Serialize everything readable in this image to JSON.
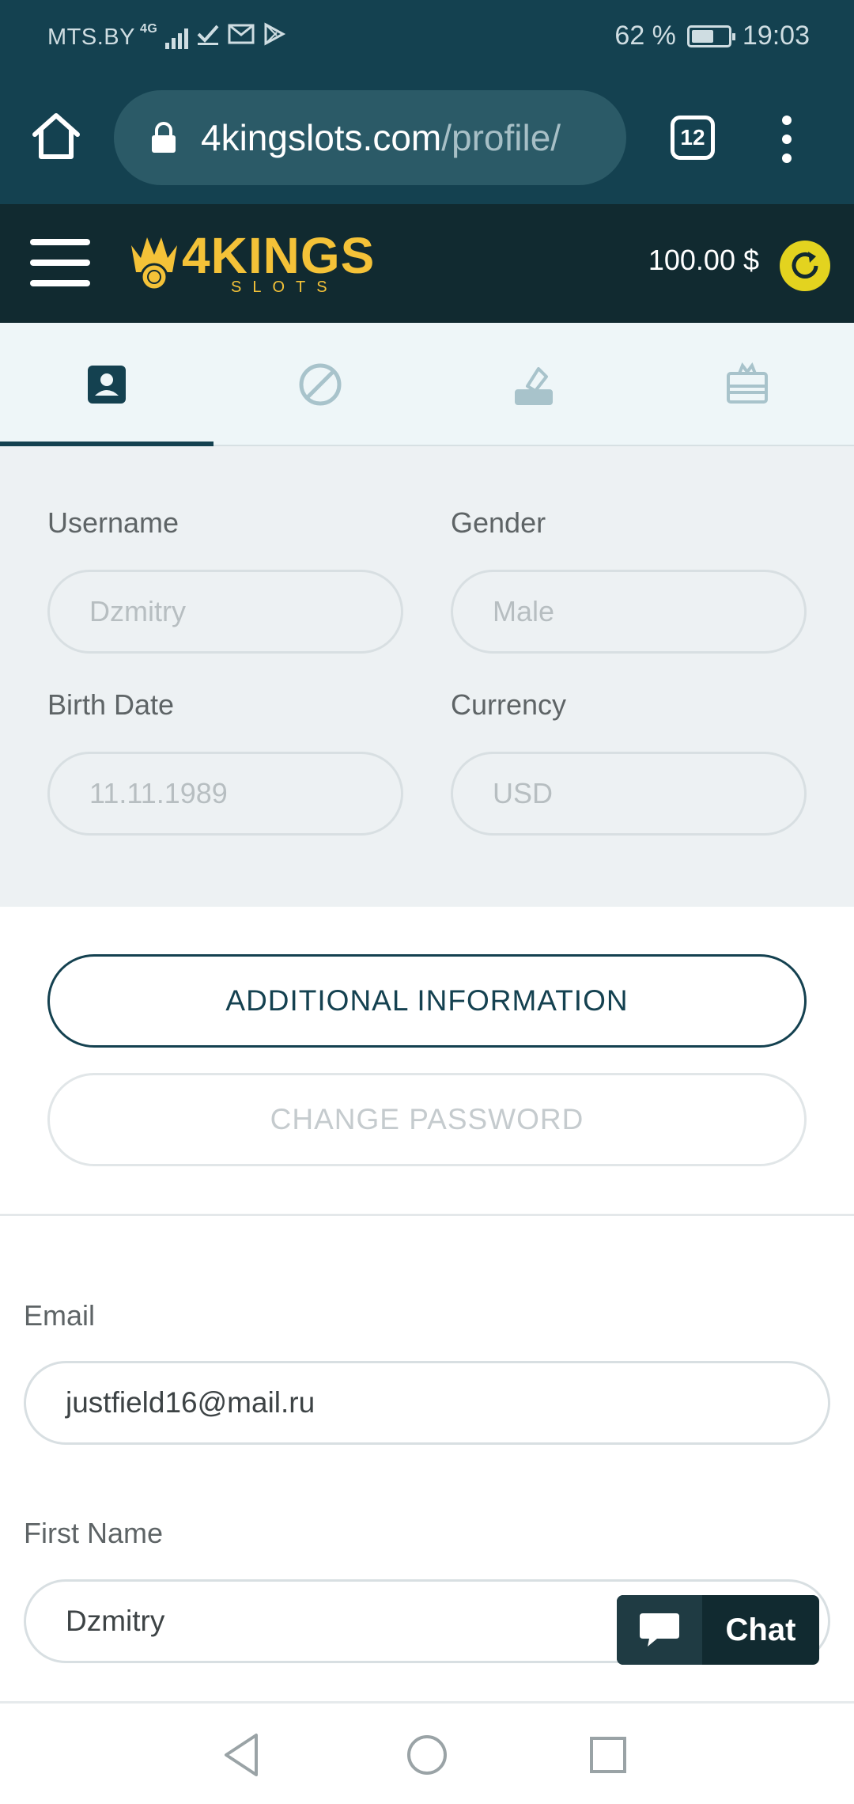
{
  "status_bar": {
    "carrier": "MTS.BY",
    "network": "4G",
    "battery": "62 %",
    "battery_level": 0.62,
    "time": "19:03"
  },
  "browser": {
    "url_host": "4kingslots.com",
    "url_path": "/profile/",
    "tab_count": "12"
  },
  "site": {
    "logo_text": "4KINGS",
    "logo_sub": "SLOTS",
    "balance": "100.00 $"
  },
  "tabs": [
    {
      "icon": "profile-icon",
      "active": true
    },
    {
      "icon": "block-icon",
      "active": false
    },
    {
      "icon": "deposit-icon",
      "active": false
    },
    {
      "icon": "gift-icon",
      "active": false
    }
  ],
  "profile": {
    "username_label": "Username",
    "username_value": "Dzmitry",
    "gender_label": "Gender",
    "gender_value": "Male",
    "birth_label": "Birth Date",
    "birth_value": "11.11.1989",
    "currency_label": "Currency",
    "currency_value": "USD"
  },
  "actions": {
    "additional_info": "ADDITIONAL INFORMATION",
    "change_password": "CHANGE PASSWORD"
  },
  "details": {
    "email_label": "Email",
    "email_value": "justfield16@mail.ru",
    "first_name_label": "First Name",
    "first_name_value": "Dzmitry"
  },
  "chat": {
    "label": "Chat"
  },
  "colors": {
    "brand_dark": "#144150",
    "header_bg": "#112a30",
    "logo_gold": "#f4c238",
    "coin_yellow": "#e3d31f"
  }
}
